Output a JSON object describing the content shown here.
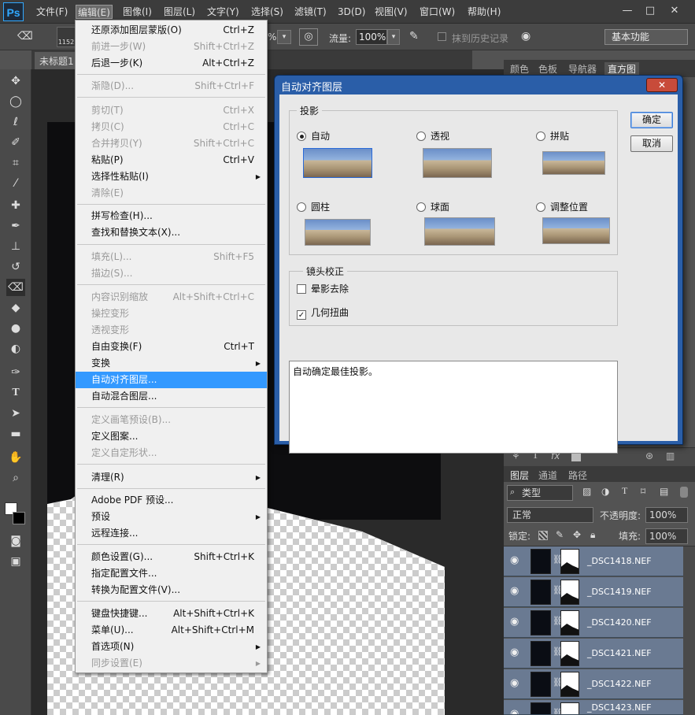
{
  "menubar": {
    "logo": "Ps",
    "items": [
      "文件(F)",
      "编辑(E)",
      "图像(I)",
      "图层(L)",
      "文字(Y)",
      "选择(S)",
      "滤镜(T)",
      "3D(D)",
      "视图(V)",
      "窗口(W)",
      "帮助(H)"
    ],
    "window_buttons": [
      "—",
      "□",
      "✕"
    ]
  },
  "options": {
    "brush_size": "1152",
    "percent_dropdown": "%",
    "flow_label": "流量:",
    "flow_value": "100%",
    "history_label": "抹到历史记录",
    "workspace": "基本功能"
  },
  "document": {
    "tab": "未标题1"
  },
  "panels": {
    "top_tabs": [
      "颜色",
      "色板",
      "导航器",
      "直方图"
    ],
    "layer_tabs": [
      "图层",
      "通道",
      "路径"
    ],
    "filter_kind": "类型",
    "blend_mode": "正常",
    "opacity_label": "不透明度:",
    "opacity_value": "100%",
    "lock_label": "锁定:",
    "fill_label": "填充:",
    "fill_value": "100%",
    "layers": [
      "_DSC1418.NEF",
      "_DSC1419.NEF",
      "_DSC1420.NEF",
      "_DSC1421.NEF",
      "_DSC1422.NEF",
      "_DSC1423.NEF"
    ]
  },
  "edit_menu": {
    "items": [
      {
        "label": "还原添加图层蒙版(O)",
        "shortcut": "Ctrl+Z",
        "disabled": false
      },
      {
        "label": "前进一步(W)",
        "shortcut": "Shift+Ctrl+Z",
        "disabled": true
      },
      {
        "label": "后退一步(K)",
        "shortcut": "Alt+Ctrl+Z",
        "disabled": false
      },
      {
        "label": "渐隐(D)...",
        "shortcut": "Shift+Ctrl+F",
        "disabled": true
      },
      {
        "label": "剪切(T)",
        "shortcut": "Ctrl+X",
        "disabled": true
      },
      {
        "label": "拷贝(C)",
        "shortcut": "Ctrl+C",
        "disabled": true
      },
      {
        "label": "合并拷贝(Y)",
        "shortcut": "Shift+Ctrl+C",
        "disabled": true
      },
      {
        "label": "粘贴(P)",
        "shortcut": "Ctrl+V",
        "disabled": false
      },
      {
        "label": "选择性粘贴(I)",
        "shortcut": "",
        "disabled": false,
        "submenu": true
      },
      {
        "label": "清除(E)",
        "shortcut": "",
        "disabled": true
      },
      {
        "label": "拼写检查(H)...",
        "shortcut": "",
        "disabled": false
      },
      {
        "label": "查找和替换文本(X)...",
        "shortcut": "",
        "disabled": false
      },
      {
        "label": "填充(L)...",
        "shortcut": "Shift+F5",
        "disabled": true
      },
      {
        "label": "描边(S)...",
        "shortcut": "",
        "disabled": true
      },
      {
        "label": "内容识别缩放",
        "shortcut": "Alt+Shift+Ctrl+C",
        "disabled": true
      },
      {
        "label": "操控变形",
        "shortcut": "",
        "disabled": true
      },
      {
        "label": "透视变形",
        "shortcut": "",
        "disabled": true
      },
      {
        "label": "自由变换(F)",
        "shortcut": "Ctrl+T",
        "disabled": false
      },
      {
        "label": "变换",
        "shortcut": "",
        "disabled": false,
        "submenu": true
      },
      {
        "label": "自动对齐图层...",
        "shortcut": "",
        "disabled": false,
        "highlighted": true
      },
      {
        "label": "自动混合图层...",
        "shortcut": "",
        "disabled": false
      },
      {
        "label": "定义画笔预设(B)...",
        "shortcut": "",
        "disabled": true
      },
      {
        "label": "定义图案...",
        "shortcut": "",
        "disabled": false
      },
      {
        "label": "定义自定形状...",
        "shortcut": "",
        "disabled": true
      },
      {
        "label": "清理(R)",
        "shortcut": "",
        "disabled": false,
        "submenu": true
      },
      {
        "label": "Adobe PDF 预设...",
        "shortcut": "",
        "disabled": false
      },
      {
        "label": "预设",
        "shortcut": "",
        "disabled": false,
        "submenu": true
      },
      {
        "label": "远程连接...",
        "shortcut": "",
        "disabled": false
      },
      {
        "label": "颜色设置(G)...",
        "shortcut": "Shift+Ctrl+K",
        "disabled": false
      },
      {
        "label": "指定配置文件...",
        "shortcut": "",
        "disabled": false
      },
      {
        "label": "转换为配置文件(V)...",
        "shortcut": "",
        "disabled": false
      },
      {
        "label": "键盘快捷键...",
        "shortcut": "Alt+Shift+Ctrl+K",
        "disabled": false
      },
      {
        "label": "菜单(U)...",
        "shortcut": "Alt+Shift+Ctrl+M",
        "disabled": false
      },
      {
        "label": "首选项(N)",
        "shortcut": "",
        "disabled": false,
        "submenu": true
      },
      {
        "label": "同步设置(E)",
        "shortcut": "",
        "disabled": true,
        "submenu": true
      }
    ]
  },
  "dialog": {
    "title": "自动对齐图层",
    "close": "✕",
    "projection_group": "投影",
    "projections": [
      {
        "label": "自动",
        "selected": true
      },
      {
        "label": "透视",
        "selected": false
      },
      {
        "label": "拼贴",
        "selected": false
      },
      {
        "label": "圆柱",
        "selected": false
      },
      {
        "label": "球面",
        "selected": false
      },
      {
        "label": "调整位置",
        "selected": false
      }
    ],
    "lens_group": "镜头校正",
    "vignette": {
      "label": "晕影去除",
      "checked": false
    },
    "distortion": {
      "label": "几何扭曲",
      "checked": true
    },
    "description": "自动确定最佳投影。",
    "ok": "确定",
    "cancel": "取消"
  }
}
